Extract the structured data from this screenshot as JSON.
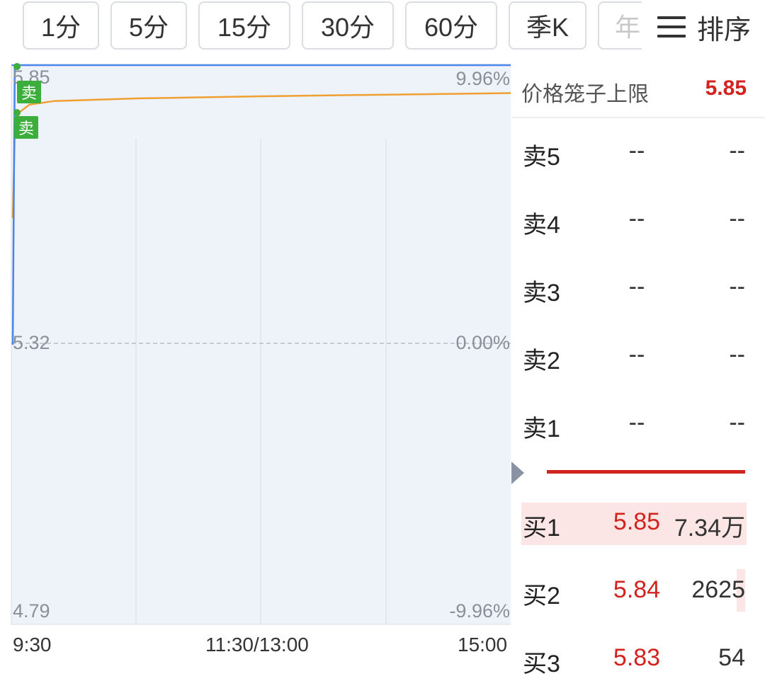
{
  "tabs": [
    {
      "label": "1分"
    },
    {
      "label": "5分"
    },
    {
      "label": "15分"
    },
    {
      "label": "30分"
    },
    {
      "label": "60分"
    },
    {
      "label": "季K"
    },
    {
      "label": "年"
    }
  ],
  "sort_button": {
    "icon": "hamburger-icon",
    "label": "排序"
  },
  "chart": {
    "price_top": "5.85",
    "price_mid": "5.32",
    "price_bottom": "4.79",
    "pct_top": "9.96%",
    "pct_mid": "0.00%",
    "pct_bottom": "-9.96%",
    "time_start": "9:30",
    "time_mid": "11:30/13:00",
    "time_end": "15:00",
    "sell_marker": "卖",
    "colors": {
      "avg_line": "#f0a030",
      "price_line": "#4a86e8",
      "fill": "#e8eef8",
      "sell_tag": "#3cae3c",
      "up": "#d3231f"
    }
  },
  "chart_data": {
    "type": "line",
    "title": "",
    "xlabel": "",
    "ylabel": "",
    "x_ticks": [
      "9:30",
      "11:30/13:00",
      "15:00"
    ],
    "y_ticks_price": [
      "5.85",
      "5.32",
      "4.79"
    ],
    "y_ticks_pct": [
      "9.96%",
      "0.00%",
      "-9.96%"
    ],
    "ylim": [
      4.79,
      5.85
    ],
    "series": [
      {
        "x": [
          0,
          1,
          3,
          8,
          20,
          60,
          120,
          180,
          240
        ],
        "values": [
          5.56,
          5.72,
          5.76,
          5.775,
          5.782,
          5.787,
          5.791,
          5.794,
          5.797
        ]
      },
      {
        "x": [
          0,
          1,
          2,
          240
        ],
        "values": [
          5.32,
          5.85,
          5.85,
          5.85
        ]
      }
    ]
  },
  "order_book": {
    "cage_label": "价格笼子上限",
    "cage_value": "5.85",
    "asks": [
      {
        "name": "卖5",
        "price": "--",
        "qty": "--"
      },
      {
        "name": "卖4",
        "price": "--",
        "qty": "--"
      },
      {
        "name": "卖3",
        "price": "--",
        "qty": "--"
      },
      {
        "name": "卖2",
        "price": "--",
        "qty": "--"
      },
      {
        "name": "卖1",
        "price": "--",
        "qty": "--"
      }
    ],
    "bids": [
      {
        "name": "买1",
        "price": "5.85",
        "qty": "7.34万"
      },
      {
        "name": "买2",
        "price": "5.84",
        "qty": "2625"
      },
      {
        "name": "买3",
        "price": "5.83",
        "qty": "54"
      }
    ]
  }
}
